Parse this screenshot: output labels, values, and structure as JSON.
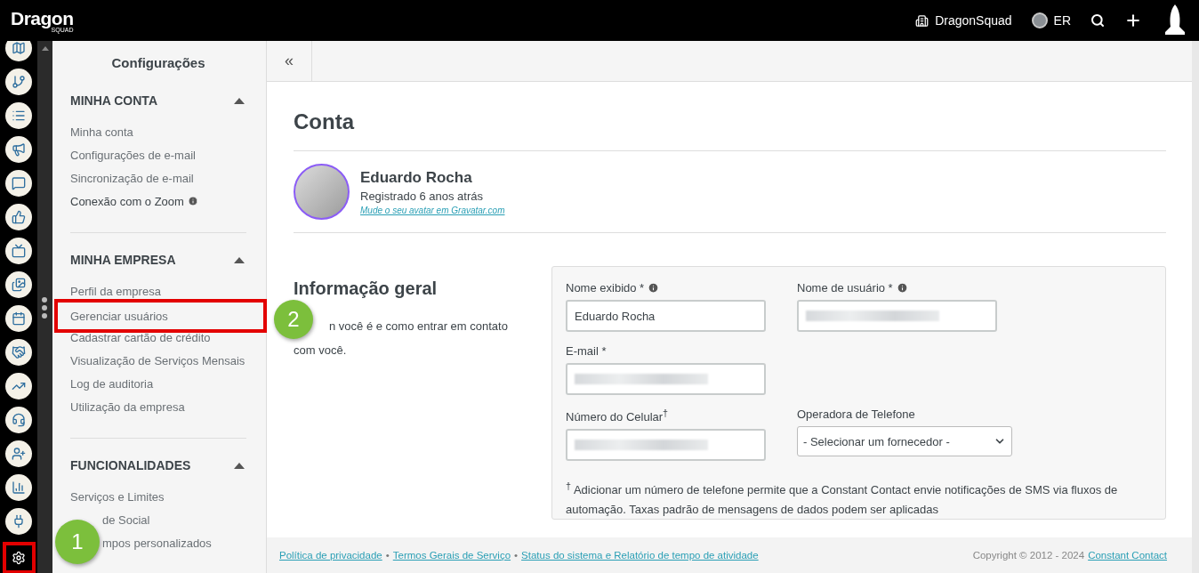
{
  "topbar": {
    "logo": "Dragon",
    "logo_sub": "SQUAD",
    "company": "DragonSquad",
    "user": "ER"
  },
  "rail": [
    {
      "kind": "map",
      "highlighted": false
    },
    {
      "kind": "branch",
      "highlighted": false
    },
    {
      "kind": "list",
      "highlighted": false
    },
    {
      "kind": "megaphone",
      "highlighted": false
    },
    {
      "kind": "chat",
      "highlighted": false
    },
    {
      "kind": "thumb",
      "highlighted": false
    },
    {
      "kind": "tv",
      "highlighted": false
    },
    {
      "kind": "images",
      "highlighted": false
    },
    {
      "kind": "calendar",
      "highlighted": false
    },
    {
      "kind": "handshake",
      "highlighted": false
    },
    {
      "kind": "trend",
      "highlighted": false
    },
    {
      "kind": "headset",
      "highlighted": false
    },
    {
      "kind": "userplus",
      "highlighted": false
    },
    {
      "kind": "bars",
      "highlighted": false
    },
    {
      "kind": "plug",
      "highlighted": false
    },
    {
      "kind": "settings",
      "highlighted": true
    }
  ],
  "sidebar": {
    "title": "Configurações",
    "sections": [
      {
        "title": "MINHA CONTA",
        "expanded": true,
        "items": [
          {
            "label": "Minha conta"
          },
          {
            "label": "Configurações de e-mail"
          },
          {
            "label": "Sincronização de e-mail"
          },
          {
            "label": "Conexão com o Zoom",
            "info": true,
            "emphasis": true
          }
        ]
      },
      {
        "title": "MINHA EMPRESA",
        "expanded": true,
        "items": [
          {
            "label": "Perfil da empresa"
          },
          {
            "label": "Gerenciar usuários",
            "highlighted": true
          },
          {
            "label": "Cadastrar cartão de crédito"
          },
          {
            "label": "Visualização de Serviços Mensais"
          },
          {
            "label": "Log de auditoria"
          },
          {
            "label": "Utilização da empresa"
          }
        ]
      },
      {
        "title": "FUNCIONALIDADES",
        "expanded": true,
        "items": [
          {
            "label": "Serviços e Limites"
          },
          {
            "label": "de Social",
            "partly_hidden": true
          },
          {
            "label": "mpos personalizados",
            "partly_hidden": true
          }
        ]
      }
    ]
  },
  "annotations": [
    {
      "label": "1",
      "kind": "rail"
    },
    {
      "label": "2",
      "kind": "main"
    }
  ],
  "main": {
    "collapse": "«",
    "title": "Conta",
    "profile": {
      "name": "Eduardo Rocha",
      "registered": "Registrado 6 anos atrás",
      "gravatar": "Mude o seu avatar em Gravatar.com"
    },
    "section": {
      "title": "Informação geral",
      "description_lines": [
        "n você é e como entrar em contato",
        "com você."
      ]
    },
    "fields": [
      {
        "kind": "text",
        "label": "Nome exibido *",
        "info": true,
        "value": "Eduardo Rocha",
        "blurred": false
      },
      {
        "kind": "text",
        "label": "Nome de usuário *",
        "info": true,
        "blurred": true
      },
      {
        "kind": "text",
        "label": "E-mail *",
        "info": false,
        "blurred": true
      },
      {
        "kind": "spacer"
      },
      {
        "kind": "text",
        "label": "Número do Celular$^{†}$",
        "info": false,
        "blurred": true
      },
      {
        "kind": "select",
        "label": "Operadora de Telefone",
        "value": "- Selecionar um fornecedor -"
      }
    ],
    "note": "$^{†}$ Adicionar um número de telefone permite que a Constant Contact envie notificações de SMS via fluxos de automação. Taxas padrão de mensagens de dados podem ser aplicadas"
  },
  "footer": {
    "links": [
      "Política de privacidade",
      "Termos Gerais de Serviço",
      "Status do sistema e Relatório de tempo de atividade"
    ],
    "separator": "•",
    "copyright": "Copyright © 2012 - 2024",
    "brand": "Constant Contact"
  }
}
